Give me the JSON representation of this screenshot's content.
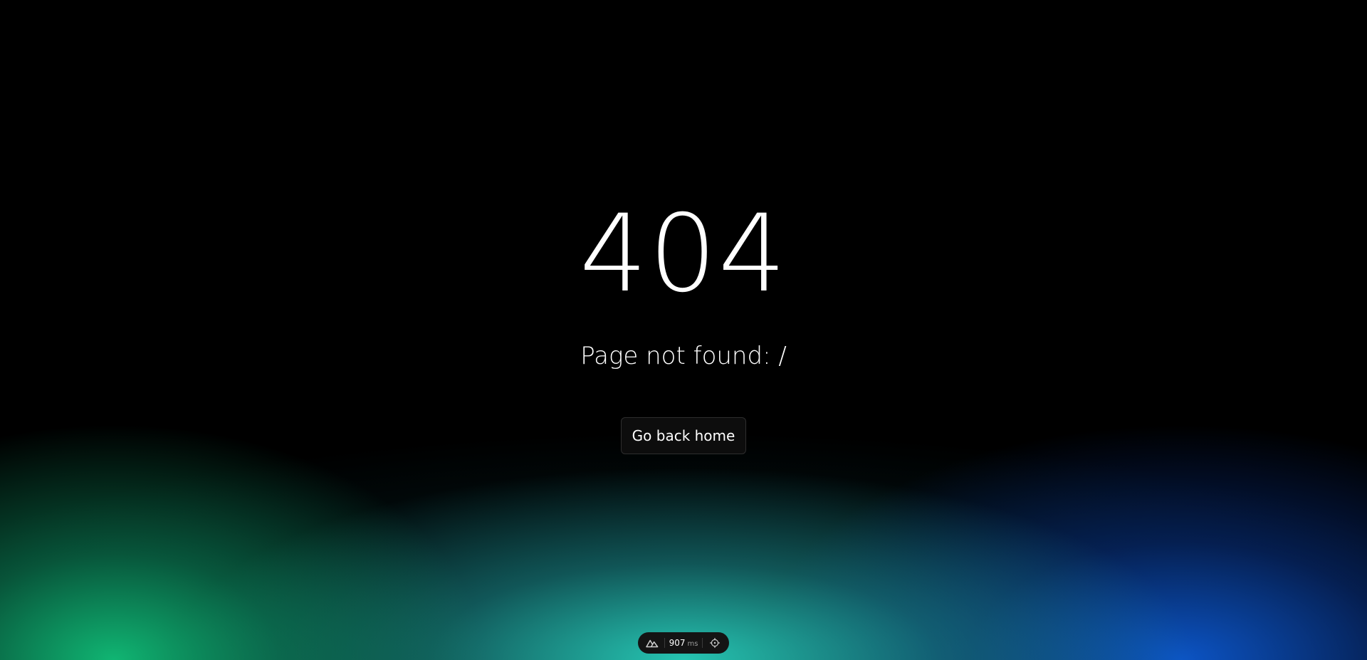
{
  "error": {
    "code": "404",
    "message": "Page not found: /"
  },
  "actions": {
    "home_button_label": "Go back home"
  },
  "devtools": {
    "logo_icon": "nuxt-logo-icon",
    "render_time_value": "907",
    "render_time_unit": "ms",
    "inspect_icon": "crosshair-icon"
  },
  "colors": {
    "background": "#000000",
    "glow_green": "#11be78",
    "glow_teal": "#28cdb9",
    "glow_blue": "#0c55c8",
    "button_bg": "#0d0d0d",
    "button_border": "#2e2e2e",
    "devbar_bg": "#141414"
  }
}
